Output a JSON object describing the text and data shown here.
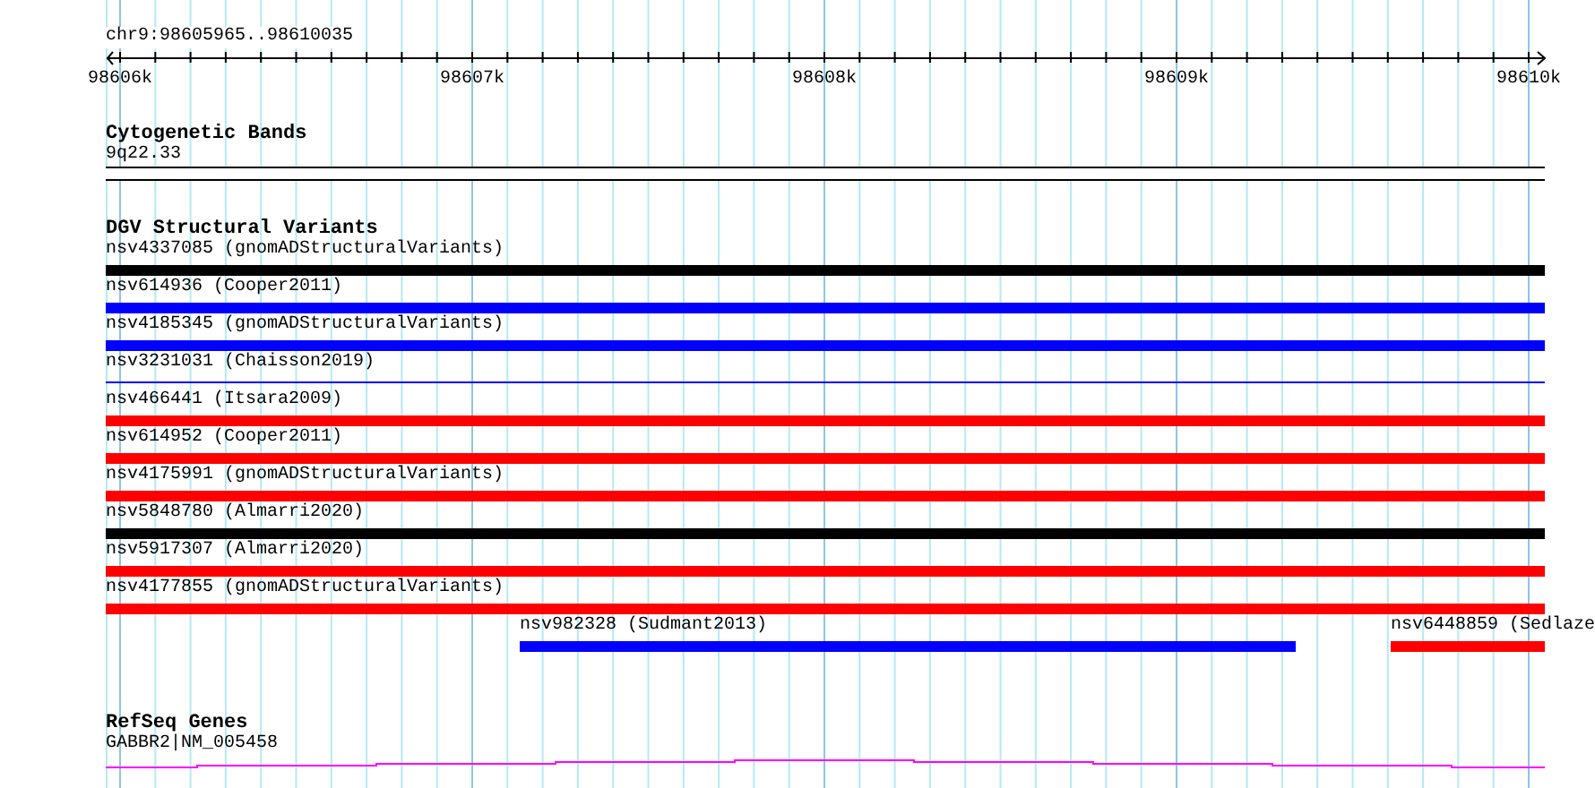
{
  "position": "chr9:98605965..98610035",
  "ruler": {
    "labels": [
      "98606k",
      "98607k",
      "98608k",
      "98609k",
      "98610k"
    ]
  },
  "cytogenetic_bands": {
    "title": "Cytogenetic Bands",
    "label": "9q22.33"
  },
  "dgv_structural_variants": {
    "title": "DGV Structural Variants",
    "rows": [
      [
        {
          "label": "nsv4337085 (gnomADStructuralVariants)",
          "color": "#000000",
          "kind": "thick"
        }
      ],
      [
        {
          "label": "nsv614936 (Cooper2011)",
          "color": "#0000ff",
          "kind": "thick"
        }
      ],
      [
        {
          "label": "nsv4185345 (gnomADStructuralVariants)",
          "color": "#0000ff",
          "kind": "thick"
        }
      ],
      [
        {
          "label": "nsv3231031 (Chaisson2019)",
          "color": "#0000ff",
          "kind": "thin"
        }
      ],
      [
        {
          "label": "nsv466441 (Itsara2009)",
          "color": "#ff0000",
          "kind": "thick"
        }
      ],
      [
        {
          "label": "nsv614952 (Cooper2011)",
          "color": "#ff0000",
          "kind": "thick"
        }
      ],
      [
        {
          "label": "nsv4175991 (gnomADStructuralVariants)",
          "color": "#ff0000",
          "kind": "thick"
        }
      ],
      [
        {
          "label": "nsv5848780 (Almarri2020)",
          "color": "#000000",
          "kind": "thick"
        }
      ],
      [
        {
          "label": "nsv5917307 (Almarri2020)",
          "color": "#ff0000",
          "kind": "thick"
        }
      ],
      [
        {
          "label": "nsv4177855 (gnomADStructuralVariants)",
          "color": "#ff0000",
          "kind": "thick"
        }
      ],
      [
        {
          "label": "nsv982328 (Sudmant2013)",
          "color": "#0000ff",
          "kind": "thick"
        },
        {
          "label": "nsv6448859 (Sedlaze",
          "color": "#ff0000",
          "kind": "thick"
        }
      ]
    ]
  },
  "refseq_genes": {
    "title": "RefSeq Genes",
    "label": "GABBR2|NM_005458"
  }
}
